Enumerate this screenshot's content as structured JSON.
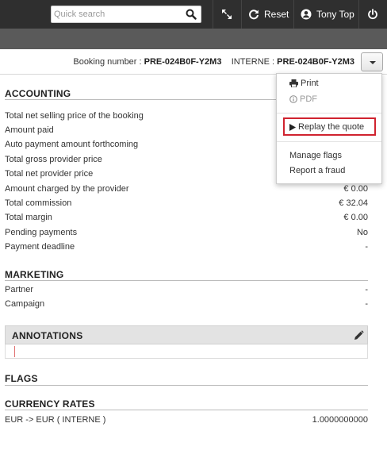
{
  "topbar": {
    "search_placeholder": "Quick search",
    "reset_label": "Reset",
    "user_name": "Tony Top"
  },
  "booking": {
    "booking_number_label": "Booking number :",
    "booking_number": "PRE-024B0F-Y2M3",
    "interne_label": "INTERNE :",
    "interne_value": "PRE-024B0F-Y2M3"
  },
  "menu": {
    "print": "Print",
    "pdf": "PDF",
    "replay": "Replay the quote",
    "manage_flags": "Manage flags",
    "report_fraud": "Report a fraud"
  },
  "accounting": {
    "title": "ACCOUNTING",
    "rows": [
      {
        "label": "Total net selling price of the booking",
        "value": ""
      },
      {
        "label": "Amount paid",
        "value": ""
      },
      {
        "label": "Auto payment amount forthcoming",
        "value": ""
      },
      {
        "label": "Total gross provider price",
        "value": ""
      },
      {
        "label": "Total net provider price",
        "value": ""
      },
      {
        "label": "Amount charged by the provider",
        "value": "€ 0.00"
      },
      {
        "label": "Total commission",
        "value": "€ 32.04"
      },
      {
        "label": "Total margin",
        "value": "€ 0.00"
      },
      {
        "label": "Pending payments",
        "value": "No"
      },
      {
        "label": "Payment deadline",
        "value": "-"
      }
    ]
  },
  "marketing": {
    "title": "MARKETING",
    "rows": [
      {
        "label": "Partner",
        "value": "-"
      },
      {
        "label": "Campaign",
        "value": "-"
      }
    ]
  },
  "annotations": {
    "title": "ANNOTATIONS"
  },
  "flags": {
    "title": "FLAGS"
  },
  "currency_rates": {
    "title": "CURRENCY RATES",
    "rows": [
      {
        "label": "EUR -> EUR ( INTERNE )",
        "value": "1.0000000000"
      }
    ]
  },
  "colors": {
    "topbar": "#2f2f2f",
    "subbar": "#5a5a5a",
    "highlight": "#d0232f"
  }
}
